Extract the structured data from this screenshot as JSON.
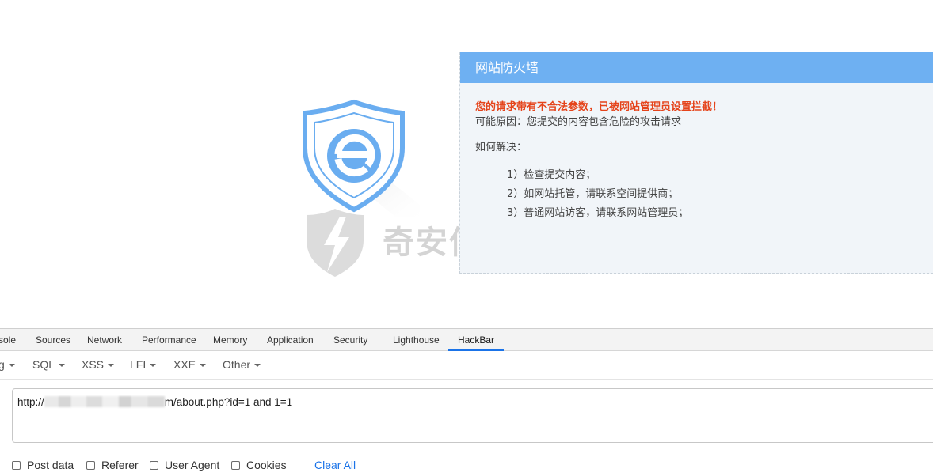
{
  "firewall": {
    "watermark_text": "奇安信攻防社区",
    "title": "网站防火墙",
    "alert": "您的请求带有不合法参数，已被网站管理员设置拦截！",
    "reason": "可能原因：您提交的内容包含危险的攻击请求",
    "howto_label": "如何解决：",
    "steps": [
      "1）检查提交内容；",
      "2）如网站托管，请联系空间提供商；",
      "3）普通网站访客，请联系网站管理员；"
    ],
    "colors": {
      "header": "#6eb0f2",
      "alert": "#e5441b",
      "panel": "#f1f5f9"
    }
  },
  "devtools": {
    "tabs": [
      "sole",
      "Sources",
      "Network",
      "Performance",
      "Memory",
      "Application",
      "Security",
      "Lighthouse",
      "HackBar"
    ],
    "active_tab": "HackBar"
  },
  "hackbar": {
    "menus": [
      "g",
      "SQL",
      "XSS",
      "LFI",
      "XXE",
      "Other"
    ],
    "url": {
      "prefix": "http://",
      "suffix": "m/about.php?id=1 and 1=1"
    },
    "options": [
      "Post data",
      "Referer",
      "User Agent",
      "Cookies"
    ],
    "clear_label": "Clear All"
  }
}
